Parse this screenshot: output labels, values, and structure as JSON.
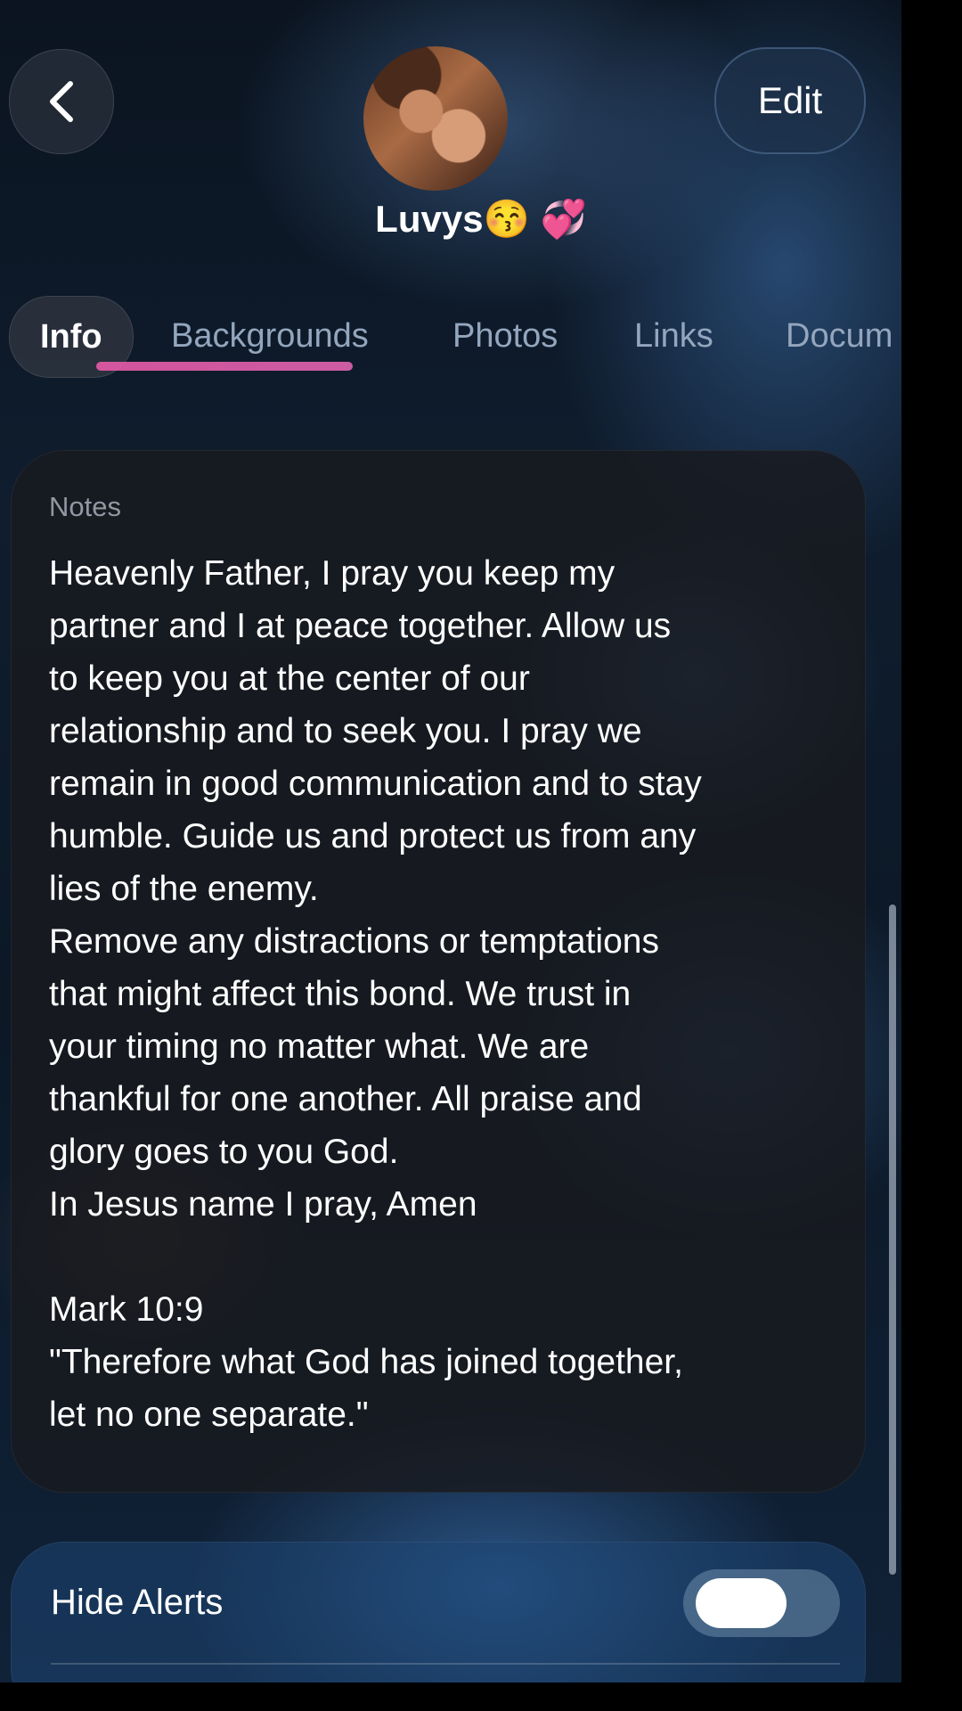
{
  "header": {
    "contact_name": "Luvys😚 💞",
    "edit_label": "Edit"
  },
  "tabs": [
    {
      "label": "Info",
      "active": true
    },
    {
      "label": "Backgrounds",
      "active": false
    },
    {
      "label": "Photos",
      "active": false
    },
    {
      "label": "Links",
      "active": false
    },
    {
      "label": "Docum",
      "active": false
    }
  ],
  "notes": {
    "label": "Notes",
    "text": "Heavenly Father, I pray you keep my\npartner and I at peace together. Allow us\nto keep you at the center of our\nrelationship and to seek you. I pray we\nremain in good communication and to stay\nhumble. Guide us and protect us from any\nlies of the enemy.\nRemove any distractions or temptations\nthat might affect this bond. We trust in\nyour timing no matter what. We are\nthankful for one another. All praise and\nglory goes to you God.\nIn Jesus name I pray, Amen\n\nMark 10:9\n\"Therefore what God has joined together,\nlet no one separate.\""
  },
  "settings": {
    "hide_alerts_label": "Hide Alerts",
    "hide_alerts_on": true
  },
  "colors": {
    "accent_underline": "#e85aa8",
    "tab_inactive": "#93a6bd"
  }
}
